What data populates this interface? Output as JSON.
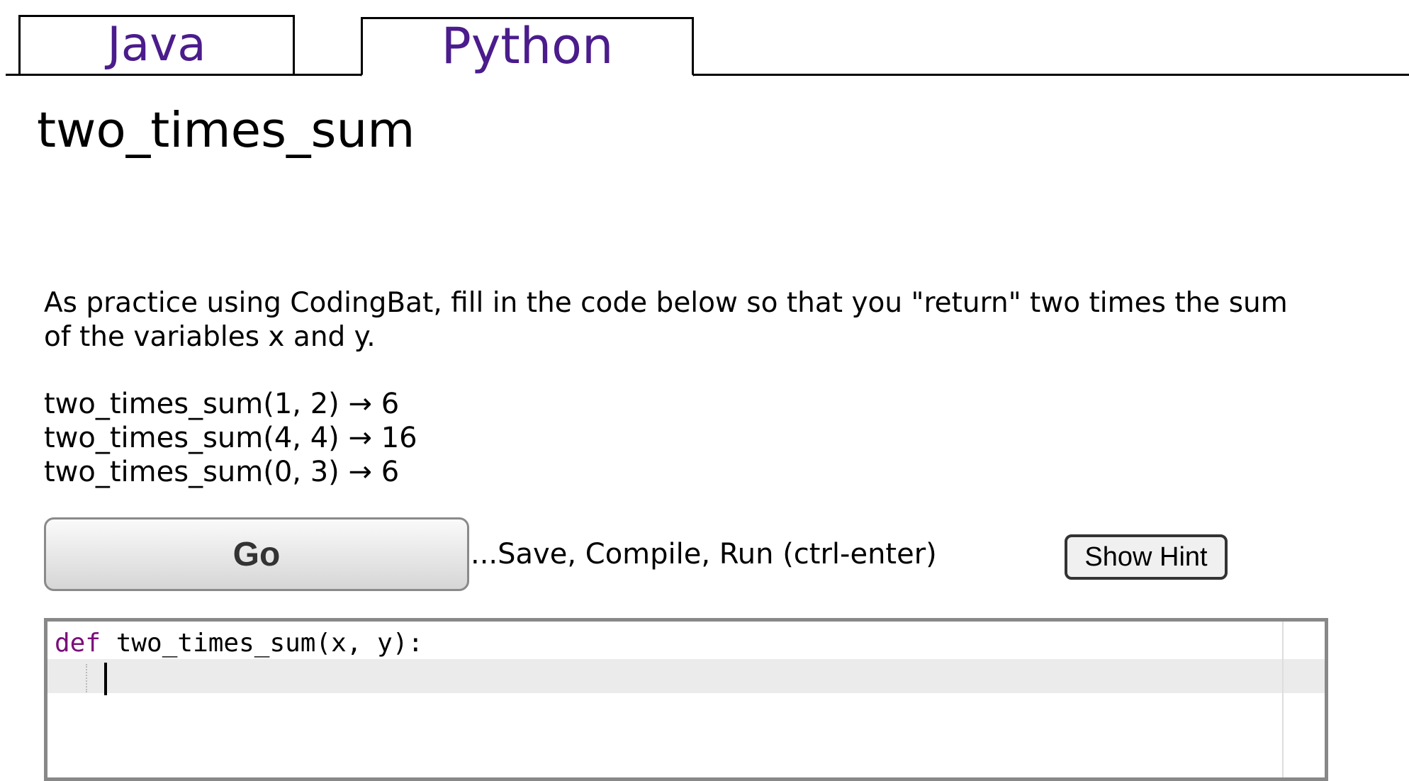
{
  "tabs": [
    {
      "label": "Java"
    },
    {
      "label": "Python"
    }
  ],
  "problem": {
    "title": "two_times_sum",
    "description": "As practice using CodingBat, fill in the code below so that you \"return\" two times the sum of the variables x and y.",
    "examples": [
      "two_times_sum(1, 2) → 6",
      "two_times_sum(4, 4) → 16",
      "two_times_sum(0, 3) → 6"
    ]
  },
  "controls": {
    "go_label": "Go",
    "go_caption": "...Save, Compile, Run (ctrl-enter)",
    "hint_label": "Show Hint"
  },
  "editor": {
    "keyword": "def",
    "signature": " two_times_sum(x, y):"
  },
  "colors": {
    "tab_text": "#4b1c8c",
    "keyword": "#7a0e7a"
  }
}
